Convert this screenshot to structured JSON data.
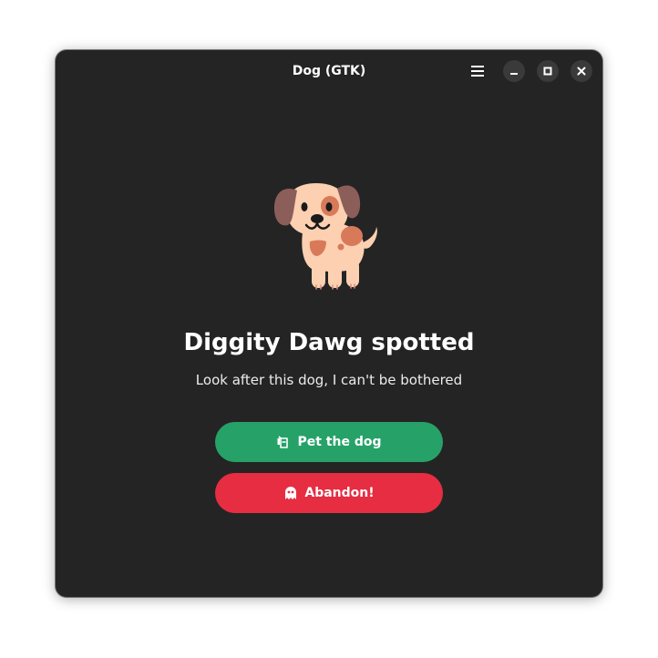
{
  "window": {
    "title": "Dog (GTK)"
  },
  "headerbar": {
    "menu_icon": "hamburger-menu-icon",
    "minimize_icon": "minimize-icon",
    "maximize_icon": "maximize-icon",
    "close_icon": "close-icon"
  },
  "content": {
    "image_icon": "dog-icon",
    "headline": "Diggity Dawg spotted",
    "subtitle": "Look after this dog, I can't be bothered"
  },
  "actions": {
    "pet": {
      "label": "Pet the dog",
      "icon": "hand-icon",
      "color": "#26a269"
    },
    "abandon": {
      "label": "Abandon!",
      "icon": "ghost-icon",
      "color": "#e62d42"
    }
  },
  "colors": {
    "window_background": "#242424",
    "control_background": "#3a3a3a",
    "text": "#ffffff"
  }
}
